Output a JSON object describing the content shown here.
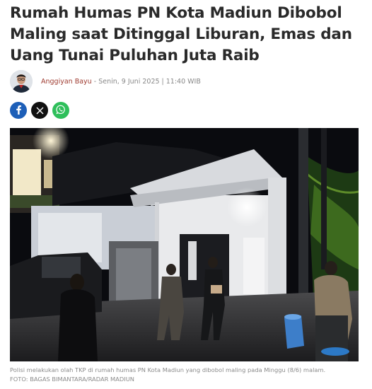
{
  "article": {
    "title_lines": [
      "Rumah Humas PN Kota Madiun Dibobol",
      "Maling saat Ditinggal Liburan, Emas dan",
      "Uang Tunai Puluhan Juta Raib"
    ],
    "author": "Anggiyan Bayu",
    "separator": "-",
    "date": "Senin, 9 Juni 2025 | 11:40 WIB"
  },
  "share": {
    "icons": [
      "facebook-icon",
      "x-icon",
      "whatsapp-icon"
    ],
    "colors": {
      "facebook": "#1d5fb8",
      "x": "#111111",
      "whatsapp": "#2fbf5b"
    }
  },
  "photo": {
    "caption": "Polisi melakukan olah TKP di rumah humas PN Kota Madiun yang dibobol maling pada Minggu (8/6) malam.",
    "credit": "FOTO: BAGAS BIMANTARA/RADAR MADIUN"
  },
  "colors": {
    "author": "#9e3a2f",
    "title": "#2a2a2a",
    "meta": "#888888"
  }
}
